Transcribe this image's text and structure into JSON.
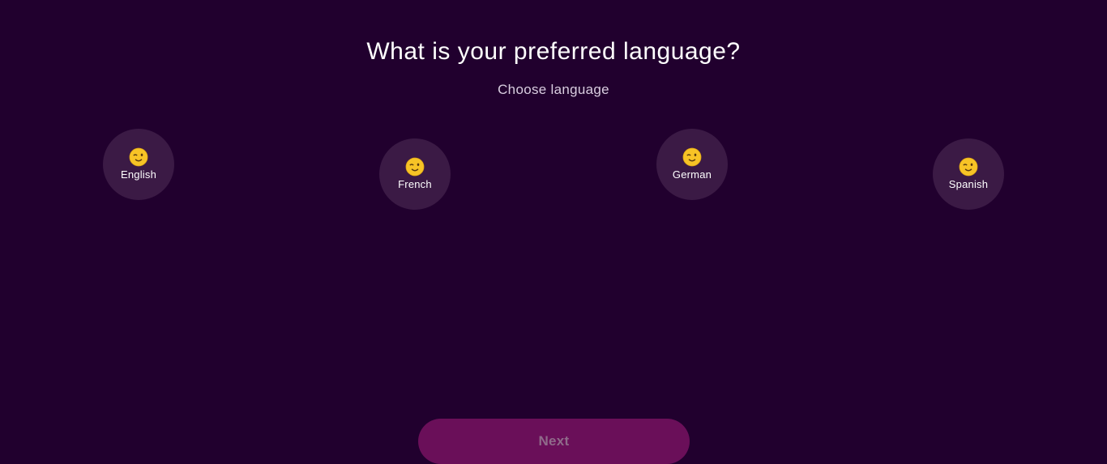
{
  "header": {
    "title": "What is your preferred language?",
    "subtitle": "Choose language"
  },
  "languages": [
    {
      "label": "English",
      "icon": "winking-face-icon"
    },
    {
      "label": "French",
      "icon": "winking-face-icon"
    },
    {
      "label": "German",
      "icon": "winking-face-icon"
    },
    {
      "label": "Spanish",
      "icon": "winking-face-icon"
    }
  ],
  "footer": {
    "next_label": "Next"
  },
  "colors": {
    "background": "#21002e",
    "option_bg": "#3b1a45",
    "button_bg": "#6a0f59",
    "button_text": "#8f6a8a"
  }
}
